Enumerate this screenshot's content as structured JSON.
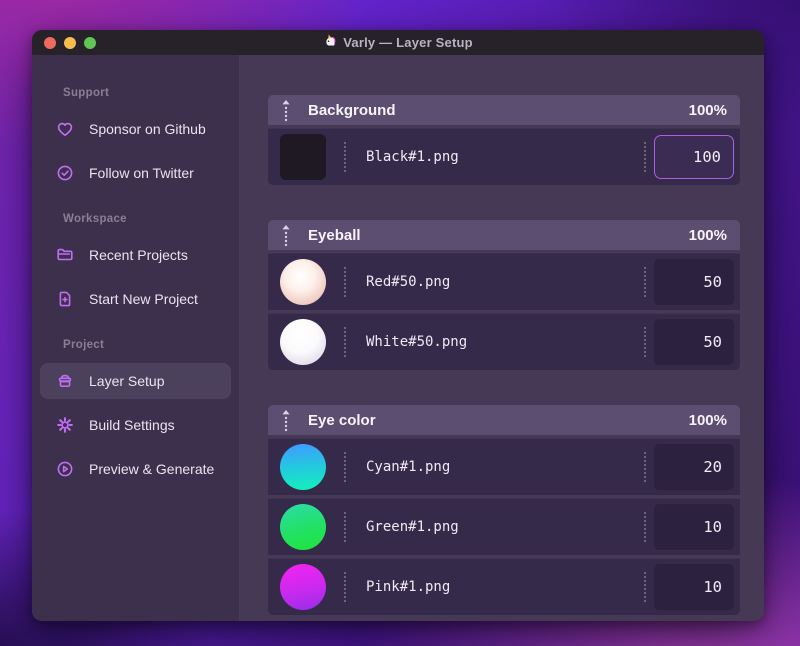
{
  "window": {
    "title": "Varly — Layer Setup",
    "app_icon": "unicorn-icon"
  },
  "colors": {
    "accent_purple": "#c16ef5",
    "focus_border": "#a960e6",
    "traffic_close": "#ee6a5f",
    "traffic_minimize": "#f5bd4f",
    "traffic_zoom": "#61c554"
  },
  "sidebar": {
    "sections": [
      {
        "label": "Support",
        "items": [
          {
            "icon": "heart-icon",
            "label": "Sponsor on Github"
          },
          {
            "icon": "badge-check-icon",
            "label": "Follow on Twitter"
          }
        ]
      },
      {
        "label": "Workspace",
        "items": [
          {
            "icon": "folder-icon",
            "label": "Recent Projects"
          },
          {
            "icon": "document-plus-icon",
            "label": "Start New Project"
          }
        ]
      },
      {
        "label": "Project",
        "items": [
          {
            "icon": "archive-box-icon",
            "label": "Layer Setup",
            "active": true
          },
          {
            "icon": "gear-icon",
            "label": "Build Settings"
          },
          {
            "icon": "play-circle-icon",
            "label": "Preview & Generate"
          }
        ]
      }
    ]
  },
  "main": {
    "groups": [
      {
        "name": "Background",
        "weight": "100%",
        "layers": [
          {
            "thumb": "black-square",
            "file": "Black#1.png",
            "value": "100",
            "focused": true
          }
        ]
      },
      {
        "name": "Eyeball",
        "weight": "100%",
        "layers": [
          {
            "thumb": "red-sphere",
            "file": "Red#50.png",
            "value": "50"
          },
          {
            "thumb": "white-sphere",
            "file": "White#50.png",
            "value": "50"
          }
        ]
      },
      {
        "name": "Eye color",
        "weight": "100%",
        "layers": [
          {
            "thumb": "cyan-sphere",
            "file": "Cyan#1.png",
            "value": "20"
          },
          {
            "thumb": "green-sphere",
            "file": "Green#1.png",
            "value": "10"
          },
          {
            "thumb": "pink-sphere",
            "file": "Pink#1.png",
            "value": "10"
          }
        ]
      }
    ]
  }
}
